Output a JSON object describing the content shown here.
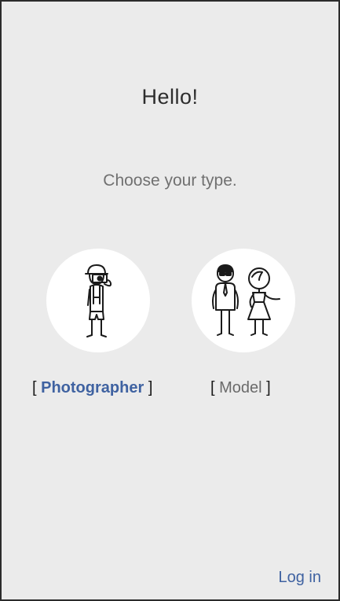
{
  "greeting": "Hello!",
  "prompt": "Choose your type.",
  "options": [
    {
      "id": "photographer",
      "open_bracket": "[",
      "label": "Photographer",
      "close_bracket": "]",
      "selected": true,
      "icon": "photographer-icon"
    },
    {
      "id": "model",
      "open_bracket": "[",
      "label": "Model",
      "close_bracket": "]",
      "selected": false,
      "icon": "models-couple-icon"
    }
  ],
  "login_label": "Log in",
  "colors": {
    "background": "#ebebeb",
    "accent": "#3f62a1",
    "circle": "#ffffff",
    "muted_text": "#707070"
  }
}
